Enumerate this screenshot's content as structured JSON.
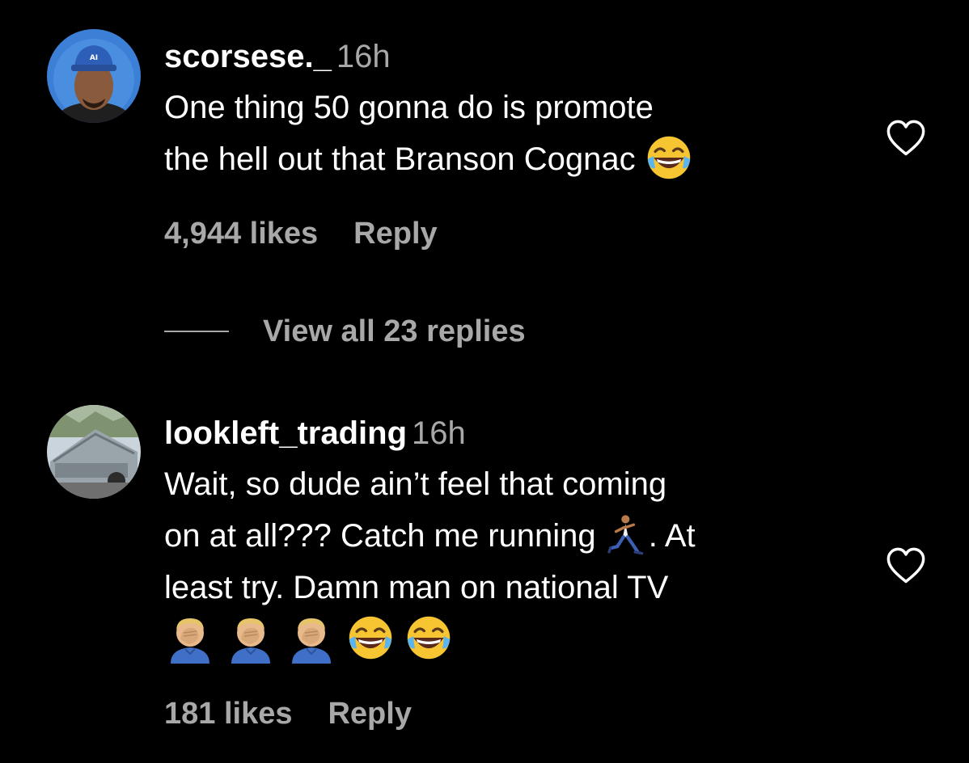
{
  "comments": [
    {
      "username": "scorsese._",
      "time": "16h",
      "lines": [
        "One thing 50 gonna do is promote",
        "the hell out that Branson Cognac"
      ],
      "likes": "4,944 likes",
      "reply_label": "Reply",
      "view_replies": "View all 23 replies"
    },
    {
      "username": "lookleft_trading",
      "time": "16h",
      "lines": [
        "Wait, so dude ain’t feel that coming",
        "on at all??? Catch me running",
        ". At",
        "least try. Damn man on national TV"
      ],
      "likes": "181 likes",
      "reply_label": "Reply"
    }
  ],
  "icons": {
    "heart": "heart-outline-icon",
    "laugh": "face-with-tears-of-joy-icon",
    "runner": "person-running-icon",
    "facepalm": "person-facepalming-icon"
  },
  "colors": {
    "background": "#000000",
    "primary_text": "#ffffff",
    "secondary_text": "#a8a8a8"
  }
}
